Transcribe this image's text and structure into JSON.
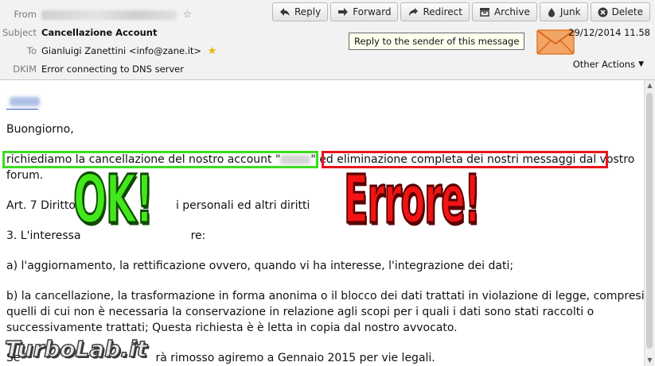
{
  "header": {
    "from_label": "From",
    "subject_label": "Subject",
    "subject": "Cancellazione Account",
    "to_label": "To",
    "to": "Gianluigi Zanettini <info@zane.it>",
    "dkim_label": "DKIM",
    "dkim_status": "Error connecting to DNS server",
    "date": "29/12/2014 11.58",
    "other_actions": "Other Actions",
    "tooltip": "Reply to the sender of this message"
  },
  "toolbar": {
    "reply": "Reply",
    "forward": "Forward",
    "redirect": "Redirect",
    "archive": "Archive",
    "junk": "Junk",
    "delete": "Delete"
  },
  "body": {
    "greeting": "Buongiorno,",
    "line1_a": "richiediamo la cancellazione del nostro account \"",
    "line1_b": "\" ed ",
    "line1_c": "eliminazione completa dei nostri messaggi dal vostro",
    "line2": "forum.",
    "line3": "Art. 7 Diritto",
    "line3b": "i personali ed altri diritti",
    "line4": "3. L'interessa",
    "line4b": "re:",
    "line5": "a) l'aggiornamento, la rettificazione ovvero, quando vi ha interesse, l'integrazione dei dati;",
    "line6": "b) la cancellazione, la trasformazione in forma anonima o il blocco dei dati trattati in violazione di legge, compresi",
    "line7": "quelli di cui non è necessaria la conservazione in relazione agli scopi per i quali i dati sono stati raccolti o",
    "line8": "successivamente trattati; Questa richiesta è è letta in copia dal nostro avvocato.",
    "line9a": "Se",
    "line9b": "rà rimosso agiremo a Gennaio 2015 per vie legali."
  },
  "overlay": {
    "ok": "OK!",
    "error": "Errore!",
    "watermark": "TurboLab.it"
  },
  "colors": {
    "ok_green": "#43e81b",
    "error_red": "#e8141c",
    "link_blue": "#2a56c6",
    "mail_orange": "#f08a3a"
  }
}
